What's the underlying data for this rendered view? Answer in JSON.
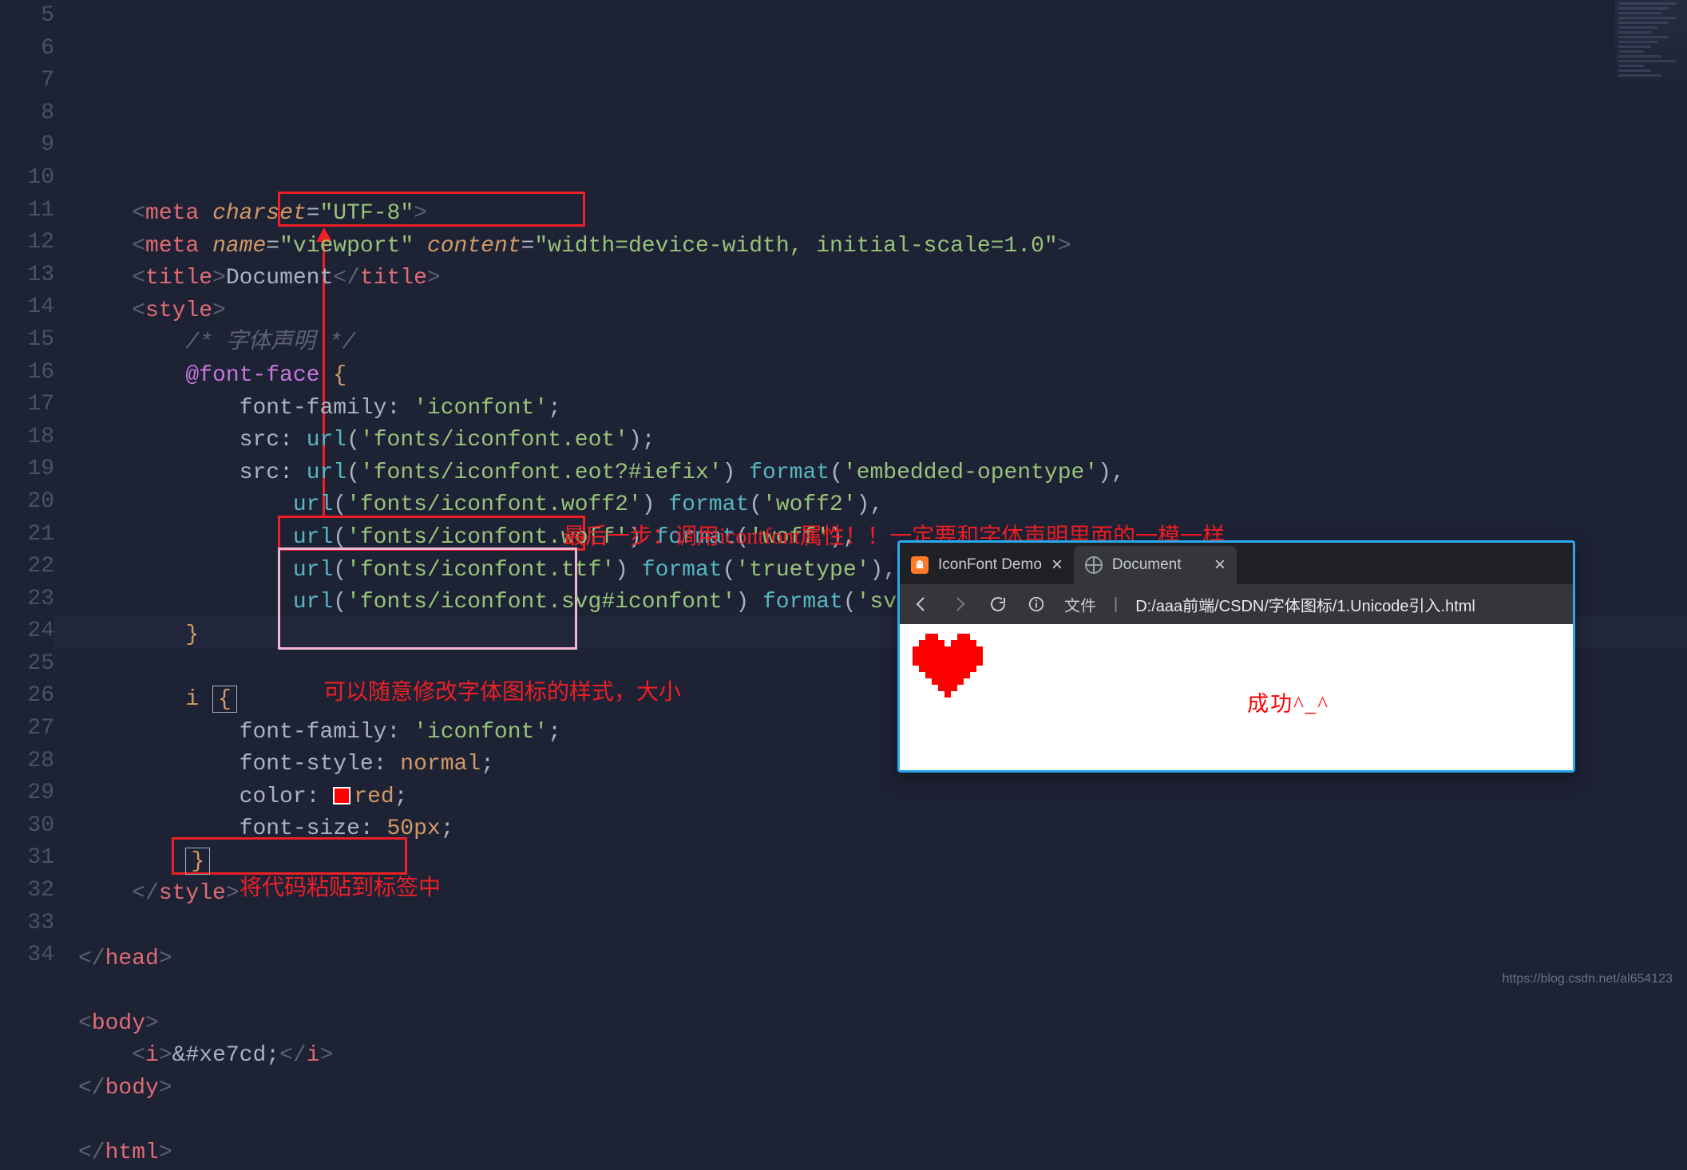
{
  "code": {
    "lines": [
      {
        "num": 5,
        "html": "    <span class='tag-bracket'>&lt;</span><span class='tag-name'>meta</span> <span class='attr-name'>charset</span><span class='attr-eq'>=</span><span class='string'>\"UTF-8\"</span><span class='tag-bracket'>&gt;</span>"
      },
      {
        "num": 6,
        "html": "    <span class='tag-bracket'>&lt;</span><span class='tag-name'>meta</span> <span class='attr-name'>name</span><span class='attr-eq'>=</span><span class='string'>\"viewport\"</span> <span class='attr-name'>content</span><span class='attr-eq'>=</span><span class='string'>\"width=device-width, initial-scale=1.0\"</span><span class='tag-bracket'>&gt;</span>"
      },
      {
        "num": 7,
        "html": "    <span class='tag-bracket'>&lt;</span><span class='tag-name'>title</span><span class='tag-bracket'>&gt;</span>Document<span class='tag-bracket'>&lt;/</span><span class='tag-name'>title</span><span class='tag-bracket'>&gt;</span>"
      },
      {
        "num": 8,
        "html": "    <span class='tag-bracket'>&lt;</span><span class='tag-name'>style</span><span class='tag-bracket'>&gt;</span>"
      },
      {
        "num": 9,
        "html": "        <span class='comment'>/* 字体声明 */</span>"
      },
      {
        "num": 10,
        "html": "        <span class='at-rule'>@font-face</span> <span class='brace'>{</span>"
      },
      {
        "num": 11,
        "html": "            <span class='prop'>font-family</span><span class='punct'>:</span> <span class='string'>'iconfont'</span><span class='punct'>;</span>"
      },
      {
        "num": 12,
        "html": "            <span class='prop'>src</span><span class='punct'>:</span> <span class='func'>url</span><span class='punct'>(</span><span class='string'>'fonts/iconfont.eot'</span><span class='punct'>)</span><span class='punct'>;</span>"
      },
      {
        "num": 13,
        "html": "            <span class='prop'>src</span><span class='punct'>:</span> <span class='func'>url</span><span class='punct'>(</span><span class='string'>'fonts/iconfont.eot?#iefix'</span><span class='punct'>)</span> <span class='func'>format</span><span class='punct'>(</span><span class='string'>'embedded-opentype'</span><span class='punct'>)</span><span class='punct'>,</span>"
      },
      {
        "num": 14,
        "html": "                <span class='func'>url</span><span class='punct'>(</span><span class='string'>'fonts/iconfont.woff2'</span><span class='punct'>)</span> <span class='func'>format</span><span class='punct'>(</span><span class='string'>'woff2'</span><span class='punct'>)</span><span class='punct'>,</span>"
      },
      {
        "num": 15,
        "html": "                <span class='func'>url</span><span class='punct'>(</span><span class='string'>'fonts/iconfont.woff'</span><span class='punct'>)</span> <span class='func'>format</span><span class='punct'>(</span><span class='string'>'woff'</span><span class='punct'>)</span><span class='punct'>,</span>"
      },
      {
        "num": 16,
        "html": "                <span class='func'>url</span><span class='punct'>(</span><span class='string'>'fonts/iconfont.ttf'</span><span class='punct'>)</span> <span class='func'>format</span><span class='punct'>(</span><span class='string'>'truetype'</span><span class='punct'>)</span><span class='punct'>,</span>"
      },
      {
        "num": 17,
        "html": "                <span class='func'>url</span><span class='punct'>(</span><span class='string'>'fonts/iconfont.svg#iconfont'</span><span class='punct'>)</span> <span class='func'>format</span><span class='punct'>(</span><span class='string'>'svg'</span><span class='punct'>)</span><span class='punct'>;</span>"
      },
      {
        "num": 18,
        "html": "        <span class='brace'>}</span>"
      },
      {
        "num": 19,
        "html": ""
      },
      {
        "num": 20,
        "html": "        <span class='selector'>i</span> <span class='boxline brace'>{</span>"
      },
      {
        "num": 21,
        "html": "            <span class='prop'>font-family</span><span class='punct'>:</span> <span class='string'>'iconfont'</span><span class='punct'>;</span>"
      },
      {
        "num": 22,
        "html": "            <span class='prop'>font-style</span><span class='punct'>:</span> <span class='value-key'>normal</span><span class='punct'>;</span>"
      },
      {
        "num": 23,
        "html": "            <span class='prop'>color</span><span class='punct'>:</span> <span class='colorchip'></span><span class='value-key'>red</span><span class='punct'>;</span>"
      },
      {
        "num": 24,
        "html": "            <span class='prop'>font-size</span><span class='punct'>:</span> <span class='value-key'>50px</span><span class='punct'>;</span>"
      },
      {
        "num": 25,
        "html": "        <span class='boxline brace'>}</span>"
      },
      {
        "num": 26,
        "html": "    <span class='tag-bracket'>&lt;/</span><span class='tag-name'>style</span><span class='tag-bracket'>&gt;</span>"
      },
      {
        "num": 27,
        "html": ""
      },
      {
        "num": 28,
        "html": "<span class='tag-bracket'>&lt;/</span><span class='tag-name'>head</span><span class='tag-bracket'>&gt;</span>"
      },
      {
        "num": 29,
        "html": ""
      },
      {
        "num": 30,
        "html": "<span class='tag-bracket'>&lt;</span><span class='tag-name'>body</span><span class='tag-bracket'>&gt;</span>"
      },
      {
        "num": 31,
        "html": "    <span class='tag-bracket'>&lt;</span><span class='tag-name'>i</span><span class='tag-bracket'>&gt;</span><span class='entity'>&amp;#xe7cd;</span><span class='tag-bracket'>&lt;/</span><span class='tag-name'>i</span><span class='tag-bracket'>&gt;</span>"
      },
      {
        "num": 32,
        "html": "<span class='tag-bracket'>&lt;/</span><span class='tag-name'>body</span><span class='tag-bracket'>&gt;</span>"
      },
      {
        "num": 33,
        "html": ""
      },
      {
        "num": 34,
        "html": "<span class='tag-bracket'>&lt;/</span><span class='tag-name'>html</span><span class='tag-bracket'>&gt;</span>"
      }
    ]
  },
  "annotations": {
    "step_last": "最后一步：调用icontfont属性！！一定要和字体声明里面的一模一样",
    "style_note": "可以随意修改字体图标的样式，大小",
    "paste_note": "将代码粘贴到标签中"
  },
  "browser": {
    "tab1": "IconFont Demo",
    "tab2": "Document",
    "addr_prefix": "文件",
    "addr_path": "D:/aaa前端/CSDN/字体图标/1.Unicode引入.html",
    "success_text": "成功^_^"
  },
  "watermark": "https://blog.csdn.net/al654123"
}
